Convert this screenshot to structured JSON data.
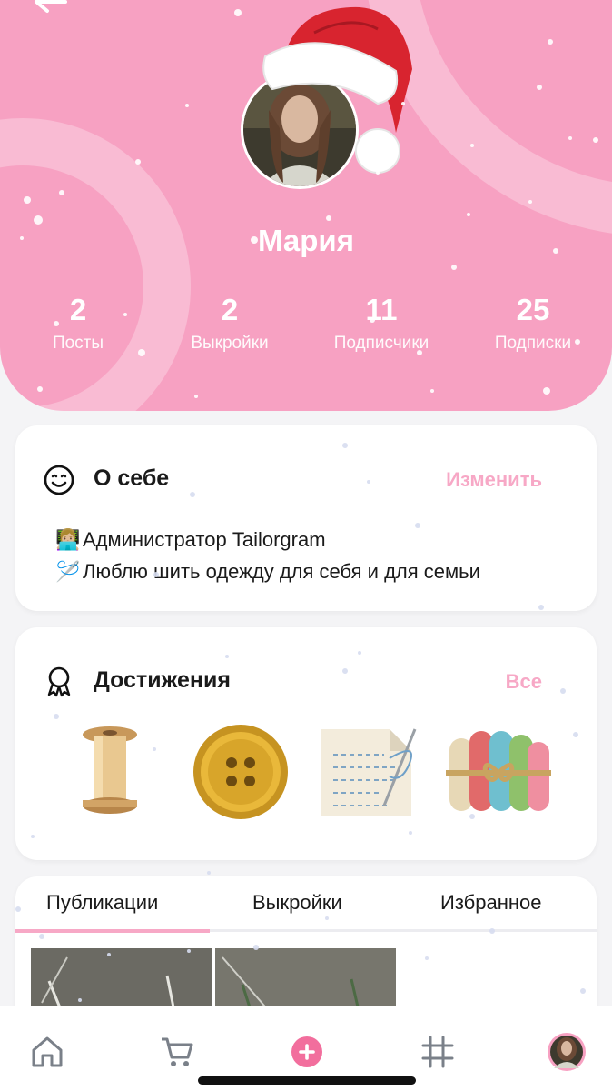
{
  "profile": {
    "name": "Мария",
    "stats": [
      {
        "value": "2",
        "label": "Посты"
      },
      {
        "value": "2",
        "label": "Выкройки"
      },
      {
        "value": "11",
        "label": "Подписчики"
      },
      {
        "value": "25",
        "label": "Подписки"
      }
    ]
  },
  "about": {
    "title": "О себе",
    "action": "Изменить",
    "lines": [
      {
        "emoji": "👩🏼‍💻",
        "text": "Администратор Tailorgram"
      },
      {
        "emoji": "🪡",
        "text": "Люблю шить одежду для себя и для семьи"
      }
    ]
  },
  "achievements": {
    "title": "Достижения",
    "action": "Все",
    "badges": [
      "spool-icon",
      "button-icon",
      "pattern-paper-icon",
      "yarn-skeins-icon"
    ]
  },
  "tabs": [
    {
      "label": "Публикации",
      "active": true
    },
    {
      "label": "Выкройки",
      "active": false
    },
    {
      "label": "Избранное",
      "active": false
    }
  ],
  "nav": [
    "home-icon",
    "cart-icon",
    "add-icon",
    "grid-icon",
    "profile-avatar"
  ],
  "colors": {
    "accent": "#f7a1c2",
    "accent_text": "#f7a8c6",
    "background": "#f4f4f6"
  }
}
